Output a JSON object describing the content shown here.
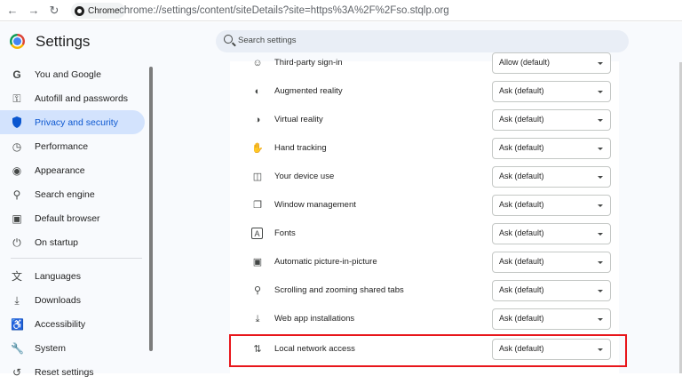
{
  "browser": {
    "chip_label": "Chrome",
    "url": "chrome://settings/content/siteDetails?site=https%3A%2F%2Fso.stqlp.org"
  },
  "header": {
    "title": "Settings",
    "search_placeholder": "Search settings"
  },
  "sidebar": {
    "items": [
      {
        "label": "You and Google",
        "icon": "google-icon",
        "active": false
      },
      {
        "label": "Autofill and passwords",
        "icon": "key-icon",
        "active": false
      },
      {
        "label": "Privacy and security",
        "icon": "shield-icon",
        "active": true
      },
      {
        "label": "Performance",
        "icon": "speedometer-icon",
        "active": false
      },
      {
        "label": "Appearance",
        "icon": "palette-icon",
        "active": false
      },
      {
        "label": "Search engine",
        "icon": "search-icon",
        "active": false
      },
      {
        "label": "Default browser",
        "icon": "browser-icon",
        "active": false
      },
      {
        "label": "On startup",
        "icon": "power-icon",
        "active": false
      },
      {
        "label": "Languages",
        "icon": "translate-icon",
        "active": false
      },
      {
        "label": "Downloads",
        "icon": "download-icon",
        "active": false
      },
      {
        "label": "Accessibility",
        "icon": "accessibility-icon",
        "active": false
      },
      {
        "label": "System",
        "icon": "wrench-icon",
        "active": false
      },
      {
        "label": "Reset settings",
        "icon": "reset-icon",
        "active": false
      }
    ]
  },
  "permissions": [
    {
      "label": "Third-party sign-in",
      "value": "Allow (default)",
      "icon": "account-icon"
    },
    {
      "label": "Augmented reality",
      "value": "Ask (default)",
      "icon": "ar-icon"
    },
    {
      "label": "Virtual reality",
      "value": "Ask (default)",
      "icon": "vr-icon"
    },
    {
      "label": "Hand tracking",
      "value": "Ask (default)",
      "icon": "hand-icon"
    },
    {
      "label": "Your device use",
      "value": "Ask (default)",
      "icon": "device-icon"
    },
    {
      "label": "Window management",
      "value": "Ask (default)",
      "icon": "window-icon"
    },
    {
      "label": "Fonts",
      "value": "Ask (default)",
      "icon": "font-icon"
    },
    {
      "label": "Automatic picture-in-picture",
      "value": "Ask (default)",
      "icon": "pip-icon"
    },
    {
      "label": "Scrolling and zooming shared tabs",
      "value": "Ask (default)",
      "icon": "zoom-tab-icon"
    },
    {
      "label": "Web app installations",
      "value": "Ask (default)",
      "icon": "install-icon"
    },
    {
      "label": "Local network access",
      "value": "Ask (default)",
      "icon": "network-icon",
      "highlighted": true
    }
  ],
  "colors": {
    "accent": "#0b57d0",
    "active_nav_bg": "#d3e3fd",
    "highlight_border": "#e8161b"
  }
}
